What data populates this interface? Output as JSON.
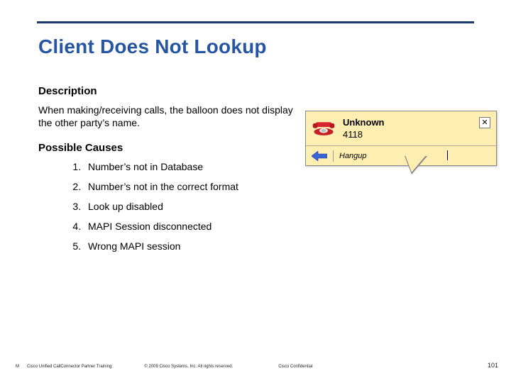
{
  "title": "Client Does Not Lookup",
  "description_heading": "Description",
  "description_text": "When making/receiving calls, the balloon does not display the other party’s name.",
  "causes_heading": "Possible Causes",
  "causes": {
    "c1": "Number’s not in Database",
    "c2": "Number’s not in the correct format",
    "c3": "Look up disabled",
    "c4": "MAPI Session disconnected",
    "c5": "Wrong MAPI session"
  },
  "balloon": {
    "caller_name": "Unknown",
    "caller_number": "4118",
    "close_symbol": "✕",
    "hangup_label": "Hangup",
    "phone_icon_name": "telephone-icon",
    "arrow_icon_name": "arrow-left-icon"
  },
  "footer": {
    "marker": "M",
    "line1": "Cisco Unified CallConnector Partner Training",
    "line2": "© 2009 Cisco Systems, Inc. All rights reserved.",
    "line3": "Cisco Confidential",
    "page": "101"
  }
}
